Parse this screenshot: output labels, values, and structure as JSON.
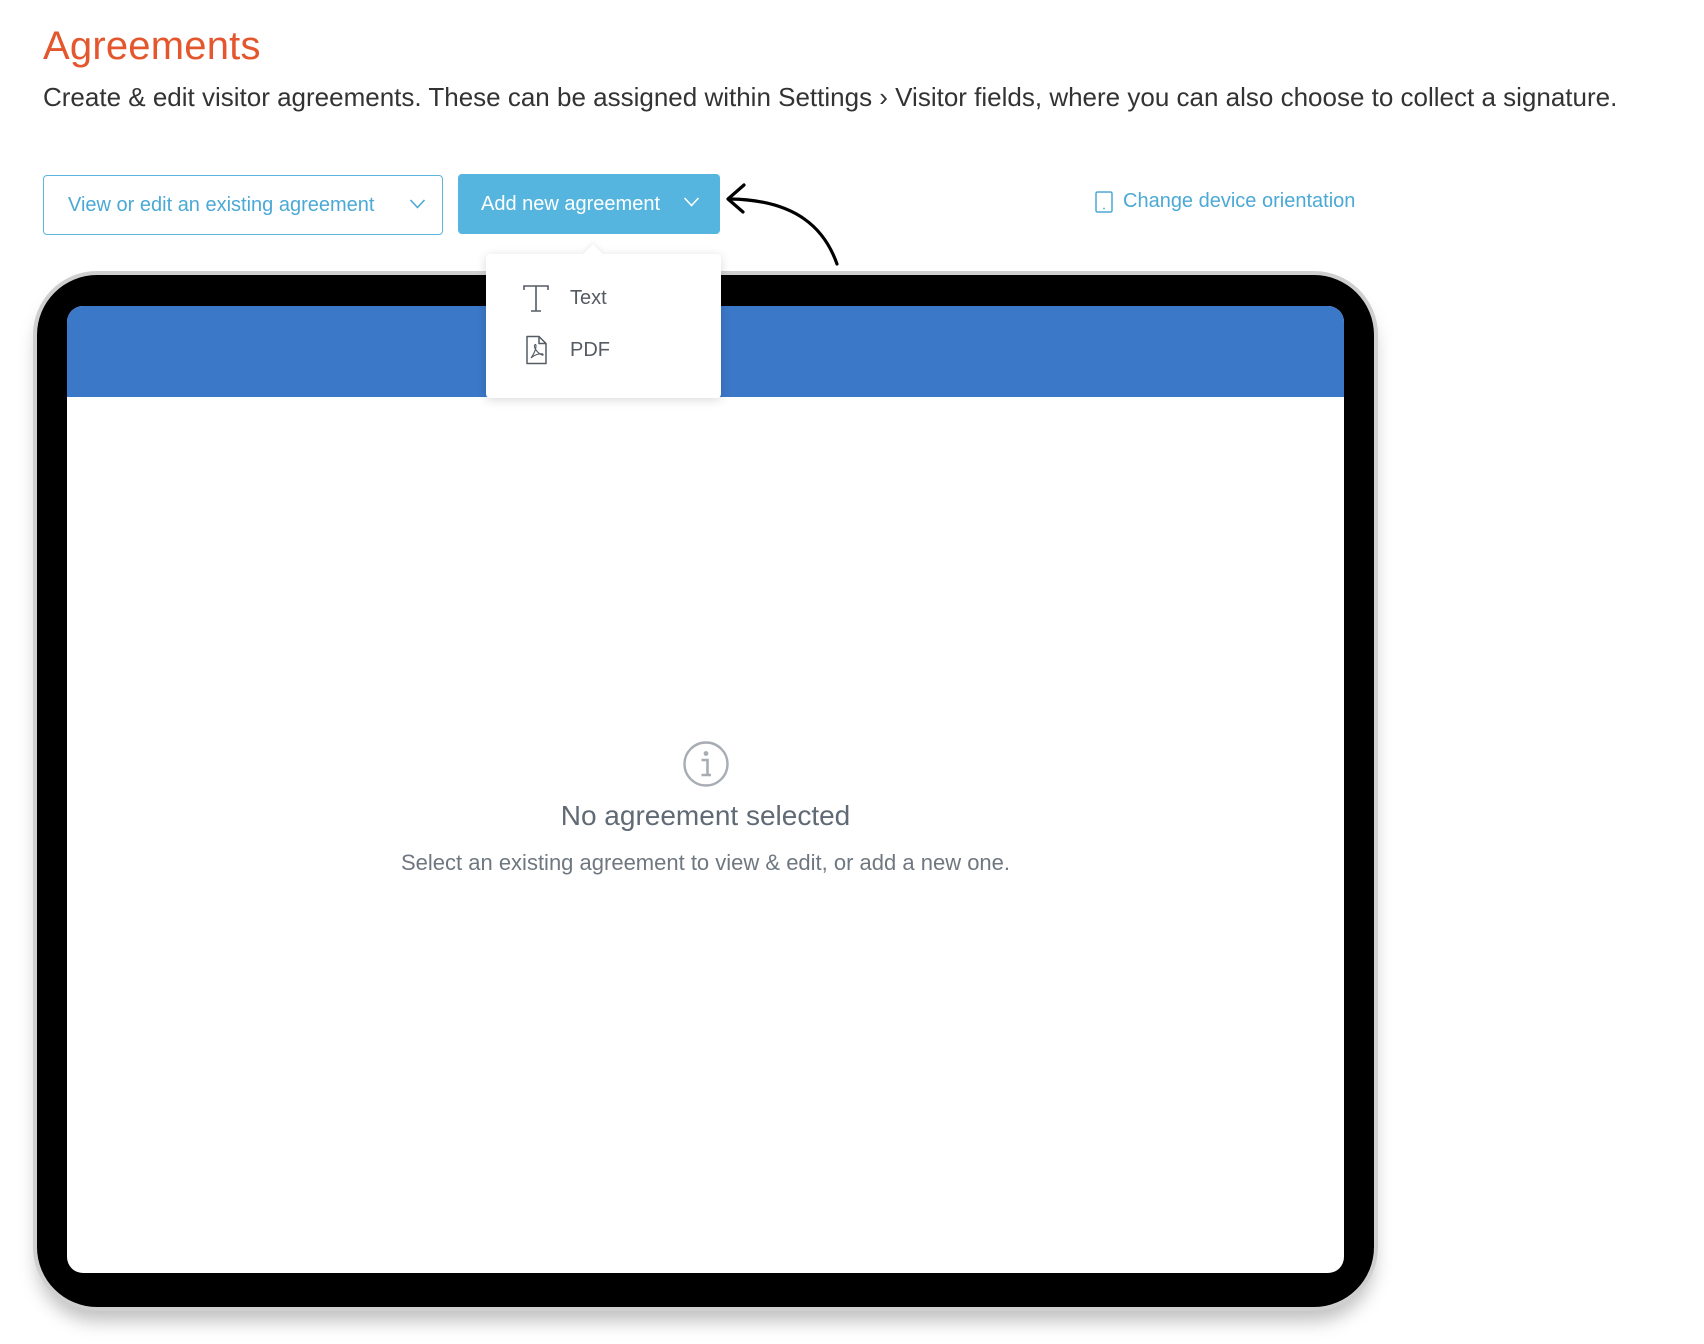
{
  "header": {
    "title": "Agreements",
    "subtitle": "Create & edit visitor agreements. These can be assigned within Settings › Visitor fields, where you can also choose to collect a signature."
  },
  "toolbar": {
    "existing_label": "View or edit an existing agreement",
    "add_label": "Add new agreement",
    "orientation_label": "Change device orientation"
  },
  "add_menu": {
    "items": [
      {
        "label": "Text",
        "icon": "text-type-icon"
      },
      {
        "label": "PDF",
        "icon": "pdf-file-icon"
      }
    ]
  },
  "empty_state": {
    "icon": "info-icon",
    "title": "No agreement selected",
    "message": "Select an existing agreement to view & edit, or add a new one."
  },
  "colors": {
    "title": "#e4572e",
    "accent": "#55b5df",
    "screen_header": "#3b78c8"
  }
}
